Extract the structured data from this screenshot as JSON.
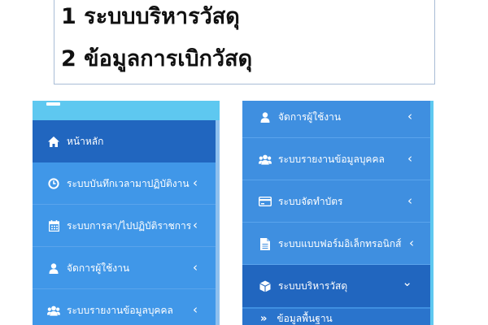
{
  "note": {
    "line1": "1 ระบบบริหารวัสดุ",
    "line2": "2 ข้อมูลการเบิกวัสดุ"
  },
  "left_menu": {
    "items": [
      {
        "label": "หน้าหลัก",
        "icon": "home-icon",
        "active": true
      },
      {
        "label": "ระบบบันทึกเวลามาปฏิบัติงาน",
        "icon": "clock-icon",
        "chevron": "‹"
      },
      {
        "label": "ระบบการลา/ไปปฏิบัติราชการ",
        "icon": "calendar-icon",
        "chevron": "‹"
      },
      {
        "label": "จัดการผู้ใช้งาน",
        "icon": "user-icon",
        "chevron": "‹"
      },
      {
        "label": "ระบบรายงานข้อมูลบุคคล",
        "icon": "users-icon",
        "chevron": "‹"
      }
    ]
  },
  "right_menu": {
    "items": [
      {
        "label": "จัดการผู้ใช้งาน",
        "icon": "user-icon",
        "chevron": "‹"
      },
      {
        "label": "ระบบรายงานข้อมูลบุคคล",
        "icon": "users-icon",
        "chevron": "‹"
      },
      {
        "label": "ระบบจัดทำบัตร",
        "icon": "credit-card-icon",
        "chevron": "‹"
      },
      {
        "label": "ระบบแบบฟอร์มอิเล็กทรอนิกส์",
        "icon": "file-icon",
        "chevron": "‹"
      },
      {
        "label": "ระบบบริหารวัสดุ",
        "icon": "cube-icon",
        "chevron": "⌄",
        "active": true
      }
    ],
    "sub_items": [
      {
        "marker": "»",
        "label": "ข้อมูลพื้นฐาน",
        "chevron": "‹"
      }
    ]
  },
  "colors": {
    "sidebar": "#4097e8",
    "active": "#2166bf",
    "topbar": "#5ec8f0"
  }
}
